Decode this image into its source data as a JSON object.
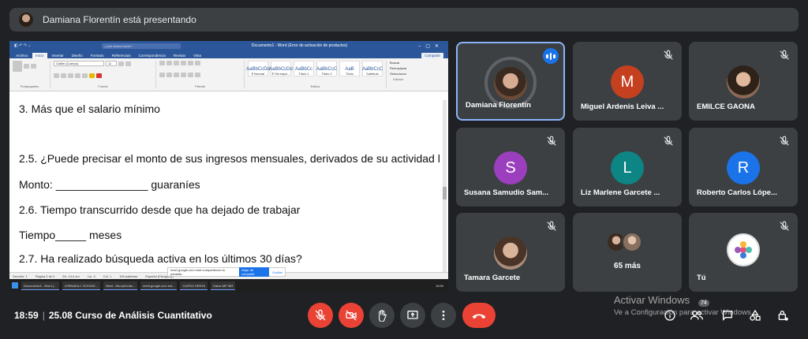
{
  "banner": {
    "text": "Damiana Florentín está presentando"
  },
  "word": {
    "doc_title": "Documento1 - Word (Error de activación de productos)",
    "search": "¿Qué desea hacer?",
    "tabs": [
      "Archivo",
      "Inicio",
      "Insertar",
      "Diseño",
      "Formato",
      "Referencias",
      "Correspondencia",
      "Revisar",
      "Vista"
    ],
    "share": "Compartir",
    "font_name": "Calibri (Cuerpo)",
    "font_size": "11",
    "groups": [
      "Portapapeles",
      "Fuente",
      "Párrafo",
      "Estilos",
      "Edición"
    ],
    "styles": [
      {
        "sample": "AaBbCcDd",
        "name": "¶ Normal"
      },
      {
        "sample": "AaBbCcDd",
        "name": "¶ Sin espa..."
      },
      {
        "sample": "AaBbCc",
        "name": "Título 1"
      },
      {
        "sample": "AaBbCcC",
        "name": "Título 2"
      },
      {
        "sample": "AaB",
        "name": "Título"
      },
      {
        "sample": "AaBbCcC",
        "name": "Subtítulo"
      }
    ],
    "edit": [
      "Buscar",
      "Reemplazar",
      "Seleccionar"
    ],
    "lines": [
      "3. Más que el salario mínimo",
      "2.5. ¿Puede precisar el monto de sus ingresos mensuales, derivados de su actividad l",
      "Monto: _______________ guaraníes",
      "2.6. Tiempo transcurrido desde que ha dejado de trabajar",
      "Tiempo_____ meses",
      "2.7. Ha realizado búsqueda activa en los últimos 30 días?"
    ],
    "status": [
      "Sección: 1",
      "Página 2 de 2",
      "En: 14,4 cm",
      "Lín. 4",
      "Col. 1",
      "159 palabras",
      "Español (Paraguay)"
    ],
    "share_notice": {
      "text": "meet.google.com está compartiendo tu pantalla.",
      "stop": "Dejar de compartir",
      "hide": "Ocultar"
    },
    "tasks": [
      "Documento1 - Word (...",
      "JORNADA 1 SOLVDE...",
      "Meet - 8ls-eyhh-ltw...",
      "meet.google.com est...",
      "CURSO SENTA",
      "Datos MP 963"
    ],
    "clock": "18:59"
  },
  "tiles": [
    {
      "name": "Damiana Florentín",
      "icon": "speaking-indicator"
    },
    {
      "name": "Miguel Ardenis Leiva ...",
      "initial": "M",
      "color": "#c5401f"
    },
    {
      "name": "EMILCE GAONA"
    },
    {
      "name": "Susana Samudio Sam...",
      "initial": "S",
      "color": "#9b3fbf"
    },
    {
      "name": "Liz Marlene Garcete ...",
      "initial": "L",
      "color": "#0d8585"
    },
    {
      "name": "Roberto Carlos Lópe...",
      "initial": "R",
      "color": "#1a73e8"
    },
    {
      "name": "Tamara Garcete"
    },
    {
      "more_label": "65 más"
    },
    {
      "name": "Tú"
    }
  ],
  "bottom": {
    "time": "18:59",
    "meeting": "25.08 Curso de Análisis Cuantitativo",
    "participants_count": "74",
    "watermark_title": "Activar Windows",
    "watermark_sub": "Ve a Configuración para activar Windows."
  }
}
